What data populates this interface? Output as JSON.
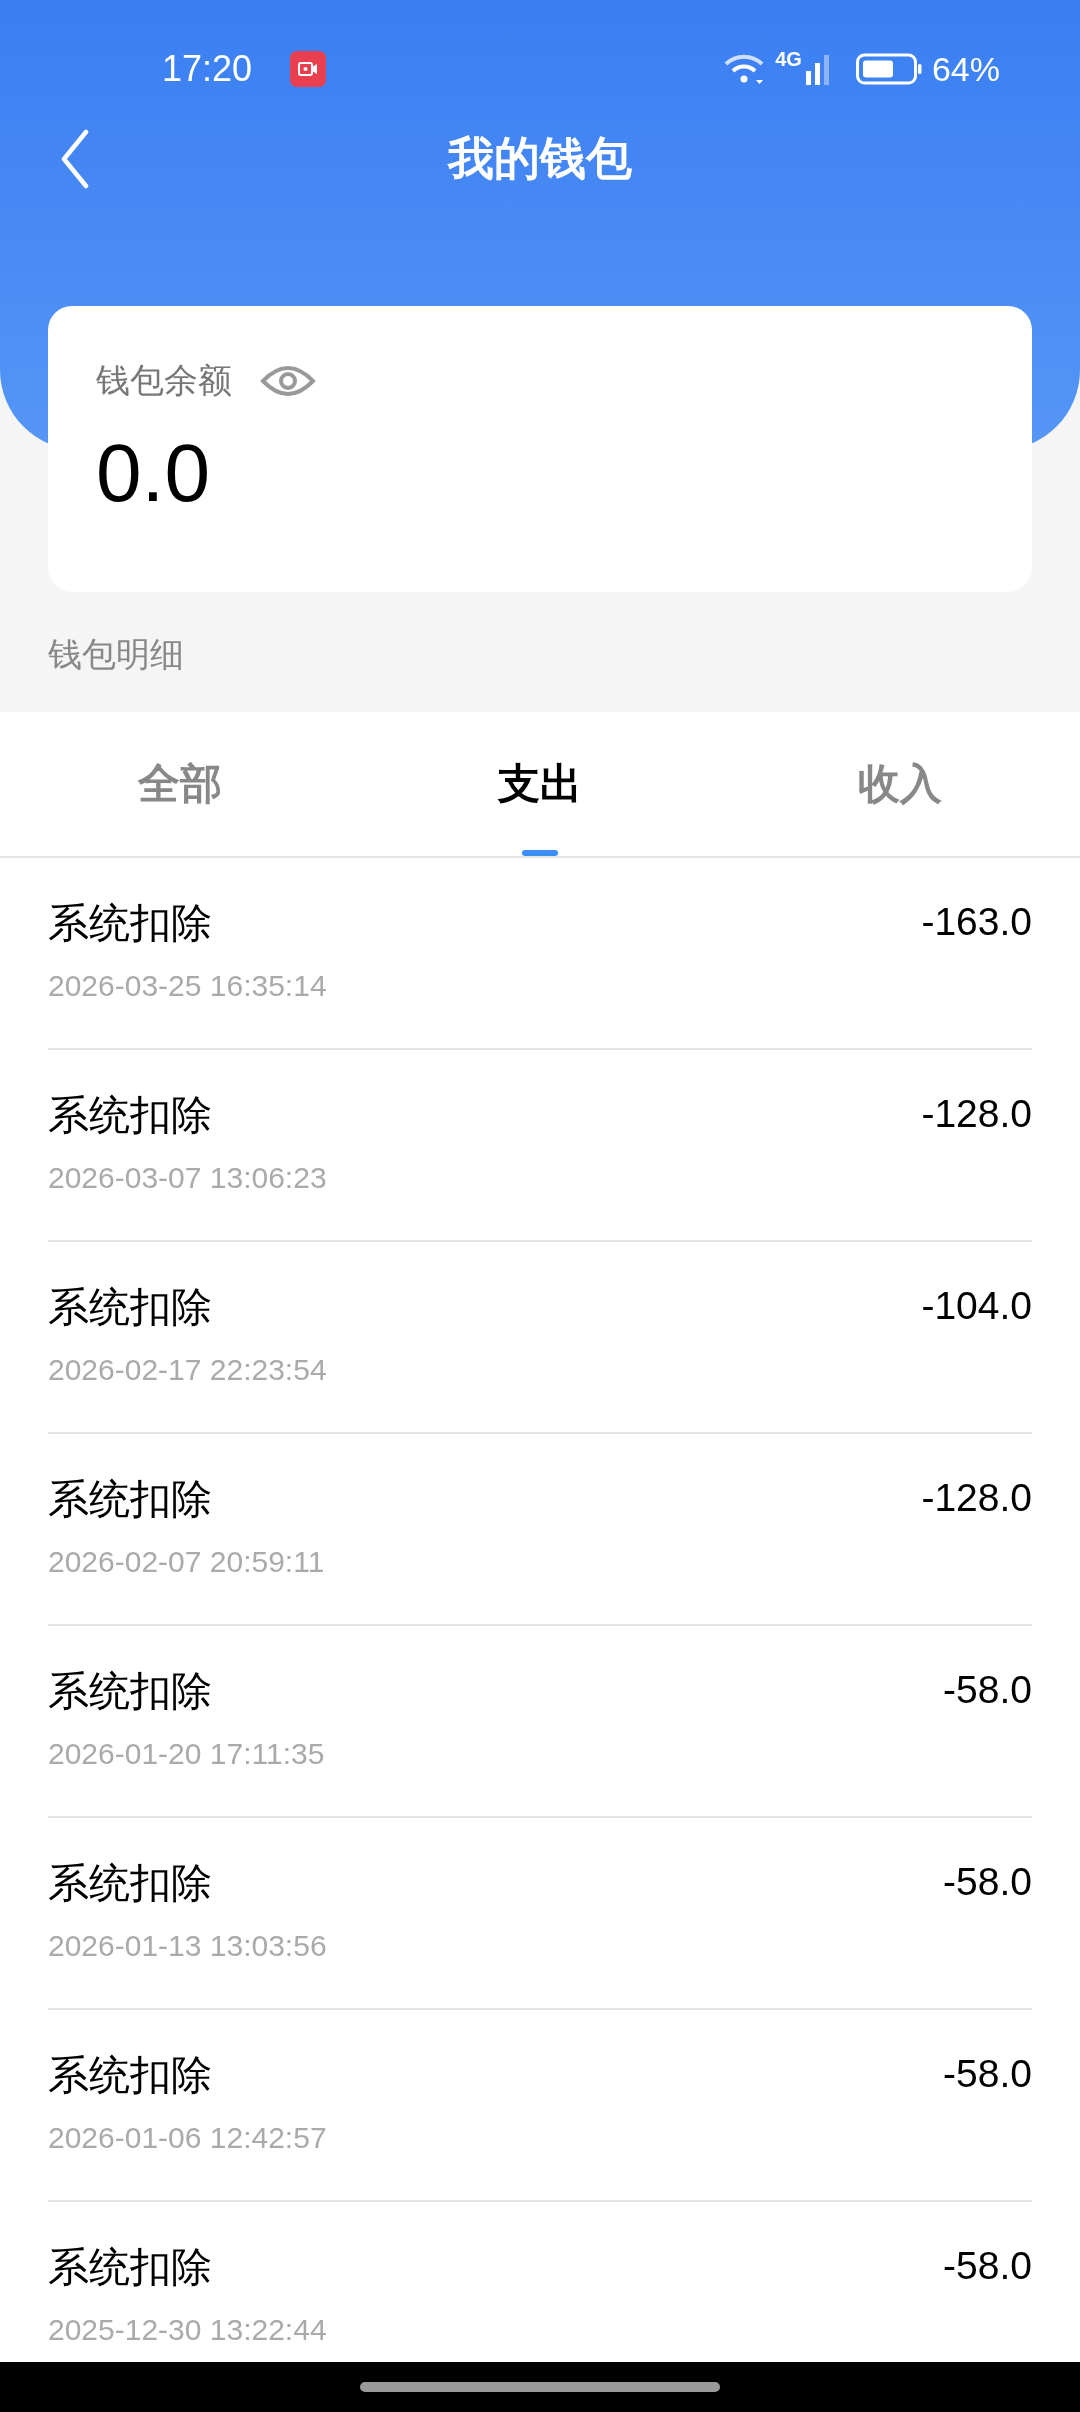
{
  "status_bar": {
    "time": "17:20",
    "network": "4G",
    "battery": "64%"
  },
  "header": {
    "title": "我的钱包"
  },
  "balance_card": {
    "label": "钱包余额",
    "amount": "0.0"
  },
  "section_title": "钱包明细",
  "tabs": [
    {
      "label": "全部",
      "selected": false
    },
    {
      "label": "支出",
      "selected": true
    },
    {
      "label": "收入",
      "selected": false
    }
  ],
  "transactions": [
    {
      "title": "系统扣除",
      "time": "2026-03-25 16:35:14",
      "amount": "-163.0"
    },
    {
      "title": "系统扣除",
      "time": "2026-03-07 13:06:23",
      "amount": "-128.0"
    },
    {
      "title": "系统扣除",
      "time": "2026-02-17 22:23:54",
      "amount": "-104.0"
    },
    {
      "title": "系统扣除",
      "time": "2026-02-07 20:59:11",
      "amount": "-128.0"
    },
    {
      "title": "系统扣除",
      "time": "2026-01-20 17:11:35",
      "amount": "-58.0"
    },
    {
      "title": "系统扣除",
      "time": "2026-01-13 13:03:56",
      "amount": "-58.0"
    },
    {
      "title": "系统扣除",
      "time": "2026-01-06 12:42:57",
      "amount": "-58.0"
    },
    {
      "title": "系统扣除",
      "time": "2025-12-30 13:22:44",
      "amount": "-58.0"
    }
  ]
}
